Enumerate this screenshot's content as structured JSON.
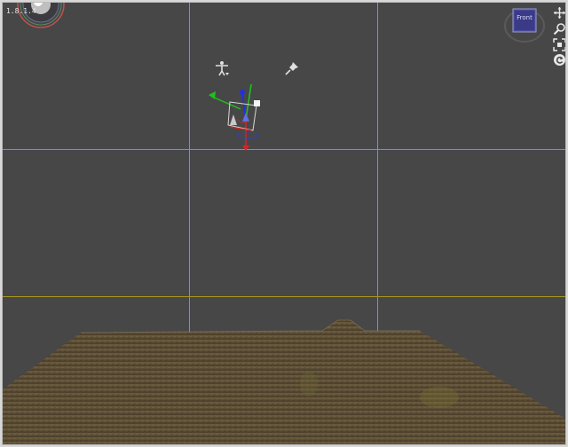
{
  "viewport": {
    "version_label": "1.8.1.4",
    "view_cube_label": "Front"
  },
  "colors": {
    "background": "#474747",
    "guide_lines": "#a89a1e",
    "axis_x": "#e02020",
    "axis_y": "#20c020",
    "axis_z": "#2030e0"
  },
  "icons": {
    "nav": [
      "move-icon",
      "zoom-icon",
      "frame-icon",
      "rotate-icon"
    ],
    "scene": [
      "figure-icon",
      "pin-icon"
    ]
  }
}
